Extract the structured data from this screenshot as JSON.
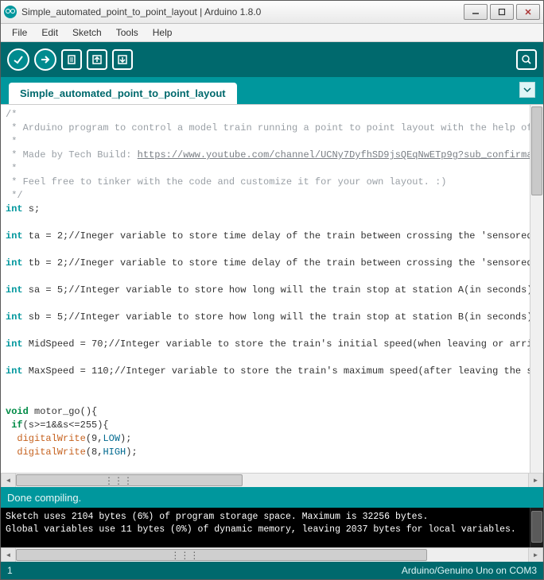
{
  "window": {
    "title": "Simple_automated_point_to_point_layout | Arduino 1.8.0",
    "buttons": {
      "min": "Minimize",
      "max": "Maximize",
      "close": "Close"
    }
  },
  "menu": {
    "file": "File",
    "edit": "Edit",
    "sketch": "Sketch",
    "tools": "Tools",
    "help": "Help"
  },
  "toolbar": {
    "verify": "Verify",
    "upload": "Upload",
    "new": "New",
    "open": "Open",
    "save": "Save",
    "serial": "Serial Monitor"
  },
  "tabs": {
    "active": "Simple_automated_point_to_point_layout"
  },
  "code": {
    "l1": "/*",
    "l2": " * Arduino program to control a model train running a point to point layout with the help of",
    "l3": " *",
    "l4_a": " * Made by Tech Build: ",
    "l4_b": "https://www.youtube.com/channel/UCNy7DyfhSD9jsQEqNwETp9g?sub_confirma",
    "l5": " *",
    "l6": " * Feel free to tinker with the code and customize it for your own layout. :)",
    "l7": " */",
    "l8_kw": "int",
    "l8_rest": " s;",
    "l10_kw": "int",
    "l10_rest": " ta = 2;//Ineger variable to store time delay of the train between crossing the 'sensored",
    "l12_kw": "int",
    "l12_rest": " tb = 2;//Ineger variable to store time delay of the train between crossing the 'sensored",
    "l14_kw": "int",
    "l14_rest": " sa = 5;//Integer variable to store how long will the train stop at station A(in seconds)",
    "l16_kw": "int",
    "l16_rest": " sb = 5;//Integer variable to store how long will the train stop at station B(in seconds)",
    "l18_kw": "int",
    "l18_rest": " MidSpeed = 70;//Integer variable to store the train's initial speed(when leaving or arri",
    "l20_kw": "int",
    "l20_rest": " MaxSpeed = 110;//Integer variable to store the train's maximum speed(after leaving the s",
    "l23_kw": "void",
    "l23_fn": " motor_go",
    "l23_rest": "(){",
    "l24_kw": " if",
    "l24_rest": "(s>=1&&s<=255){",
    "l25_fn": "  digitalWrite",
    "l25_rest": "(9,",
    "l25_const": "LOW",
    "l25_end": ");",
    "l26_fn": "  digitalWrite",
    "l26_rest": "(8,",
    "l26_const": "HIGH",
    "l26_end": ");"
  },
  "status": {
    "text": "Done compiling."
  },
  "console": {
    "l1": "Sketch uses 2104 bytes (6%) of program storage space. Maximum is 32256 bytes.",
    "l2": "Global variables use 11 bytes (0%) of dynamic memory, leaving 2037 bytes for local variables."
  },
  "bottom": {
    "line": "1",
    "board": "Arduino/Genuino Uno on COM3"
  }
}
